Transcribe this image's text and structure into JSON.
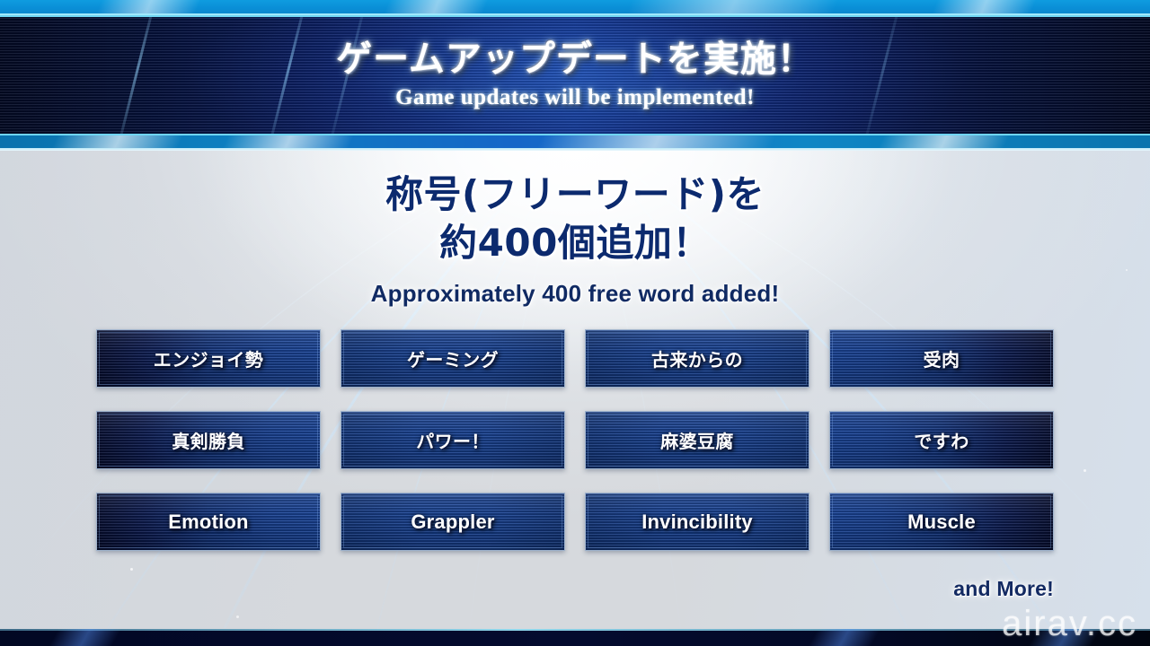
{
  "banner": {
    "title_jp": "ゲームアップデートを実施！",
    "title_en": "Game updates will be implemented!"
  },
  "headline": {
    "jp_line1": "称号(フリーワード)を",
    "jp_line2": "約400個追加！",
    "en": "Approximately 400 free word added!"
  },
  "chips": [
    {
      "label": "エンジョイ勢",
      "lang": "jp",
      "fade": "left"
    },
    {
      "label": "ゲーミング",
      "lang": "jp",
      "fade": "none"
    },
    {
      "label": "古来からの",
      "lang": "jp",
      "fade": "none"
    },
    {
      "label": "受肉",
      "lang": "jp",
      "fade": "right"
    },
    {
      "label": "真剣勝負",
      "lang": "jp",
      "fade": "left"
    },
    {
      "label": "パワー！",
      "lang": "jp",
      "fade": "none"
    },
    {
      "label": "麻婆豆腐",
      "lang": "jp",
      "fade": "none"
    },
    {
      "label": "ですわ",
      "lang": "jp",
      "fade": "right"
    },
    {
      "label": "Emotion",
      "lang": "en",
      "fade": "left"
    },
    {
      "label": "Grappler",
      "lang": "en",
      "fade": "none"
    },
    {
      "label": "Invincibility",
      "lang": "en",
      "fade": "none"
    },
    {
      "label": "Muscle",
      "lang": "en",
      "fade": "right"
    }
  ],
  "footer": {
    "and_more": "and More!",
    "watermark": "airav.cc"
  },
  "colors": {
    "page_bg": "#dcdee1",
    "banner_navy": "#030a24",
    "banner_blue": "#12378f",
    "accent_cyan": "#6fd5f2",
    "strip_blue": "#0a8ed6",
    "chip_blue": "#174296",
    "chip_dark": "#060e33",
    "headline_navy": "#0c2a6e",
    "text_white": "#ffffff"
  }
}
